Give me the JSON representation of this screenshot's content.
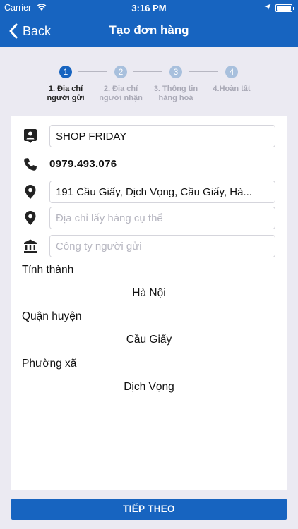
{
  "status_bar": {
    "carrier": "Carrier",
    "time": "3:16 PM"
  },
  "nav": {
    "back_label": "Back",
    "title": "Tạo đơn hàng"
  },
  "stepper": {
    "steps": [
      {
        "number": "1",
        "label_line1": "1. Địa chỉ",
        "label_line2": "người gửi",
        "active": true
      },
      {
        "number": "2",
        "label_line1": "2. Địa chỉ",
        "label_line2": "người nhận",
        "active": false
      },
      {
        "number": "3",
        "label_line1": "3. Thông tin",
        "label_line2": "hàng hoá",
        "active": false
      },
      {
        "number": "4",
        "label_line1": "4.Hoàn tất",
        "label_line2": "",
        "active": false
      }
    ]
  },
  "form": {
    "sender_name": {
      "icon": "contact-card-icon",
      "value": "SHOP FRIDAY"
    },
    "phone": {
      "icon": "phone-icon",
      "value": "0979.493.076"
    },
    "address": {
      "icon": "location-pin-icon",
      "value": "191 Cầu Giấy, Dịch Vọng, Cầu Giấy, Hà..."
    },
    "pickup_address": {
      "icon": "location-pin-icon",
      "placeholder": "Địa chỉ lấy hàng cụ thể"
    },
    "company": {
      "icon": "bank-icon",
      "placeholder": "Công ty người gửi"
    }
  },
  "location": {
    "province_label": "Tỉnh thành",
    "province_value": "Hà Nội",
    "district_label": "Quận huyện",
    "district_value": "Cầu Giấy",
    "ward_label": "Phường xã",
    "ward_value": "Dịch Vọng"
  },
  "footer": {
    "next_label": "TIẾP THEO"
  },
  "colors": {
    "primary": "#1764c0",
    "background": "#ebeaf2",
    "inactive_step": "#a8c0dd"
  }
}
